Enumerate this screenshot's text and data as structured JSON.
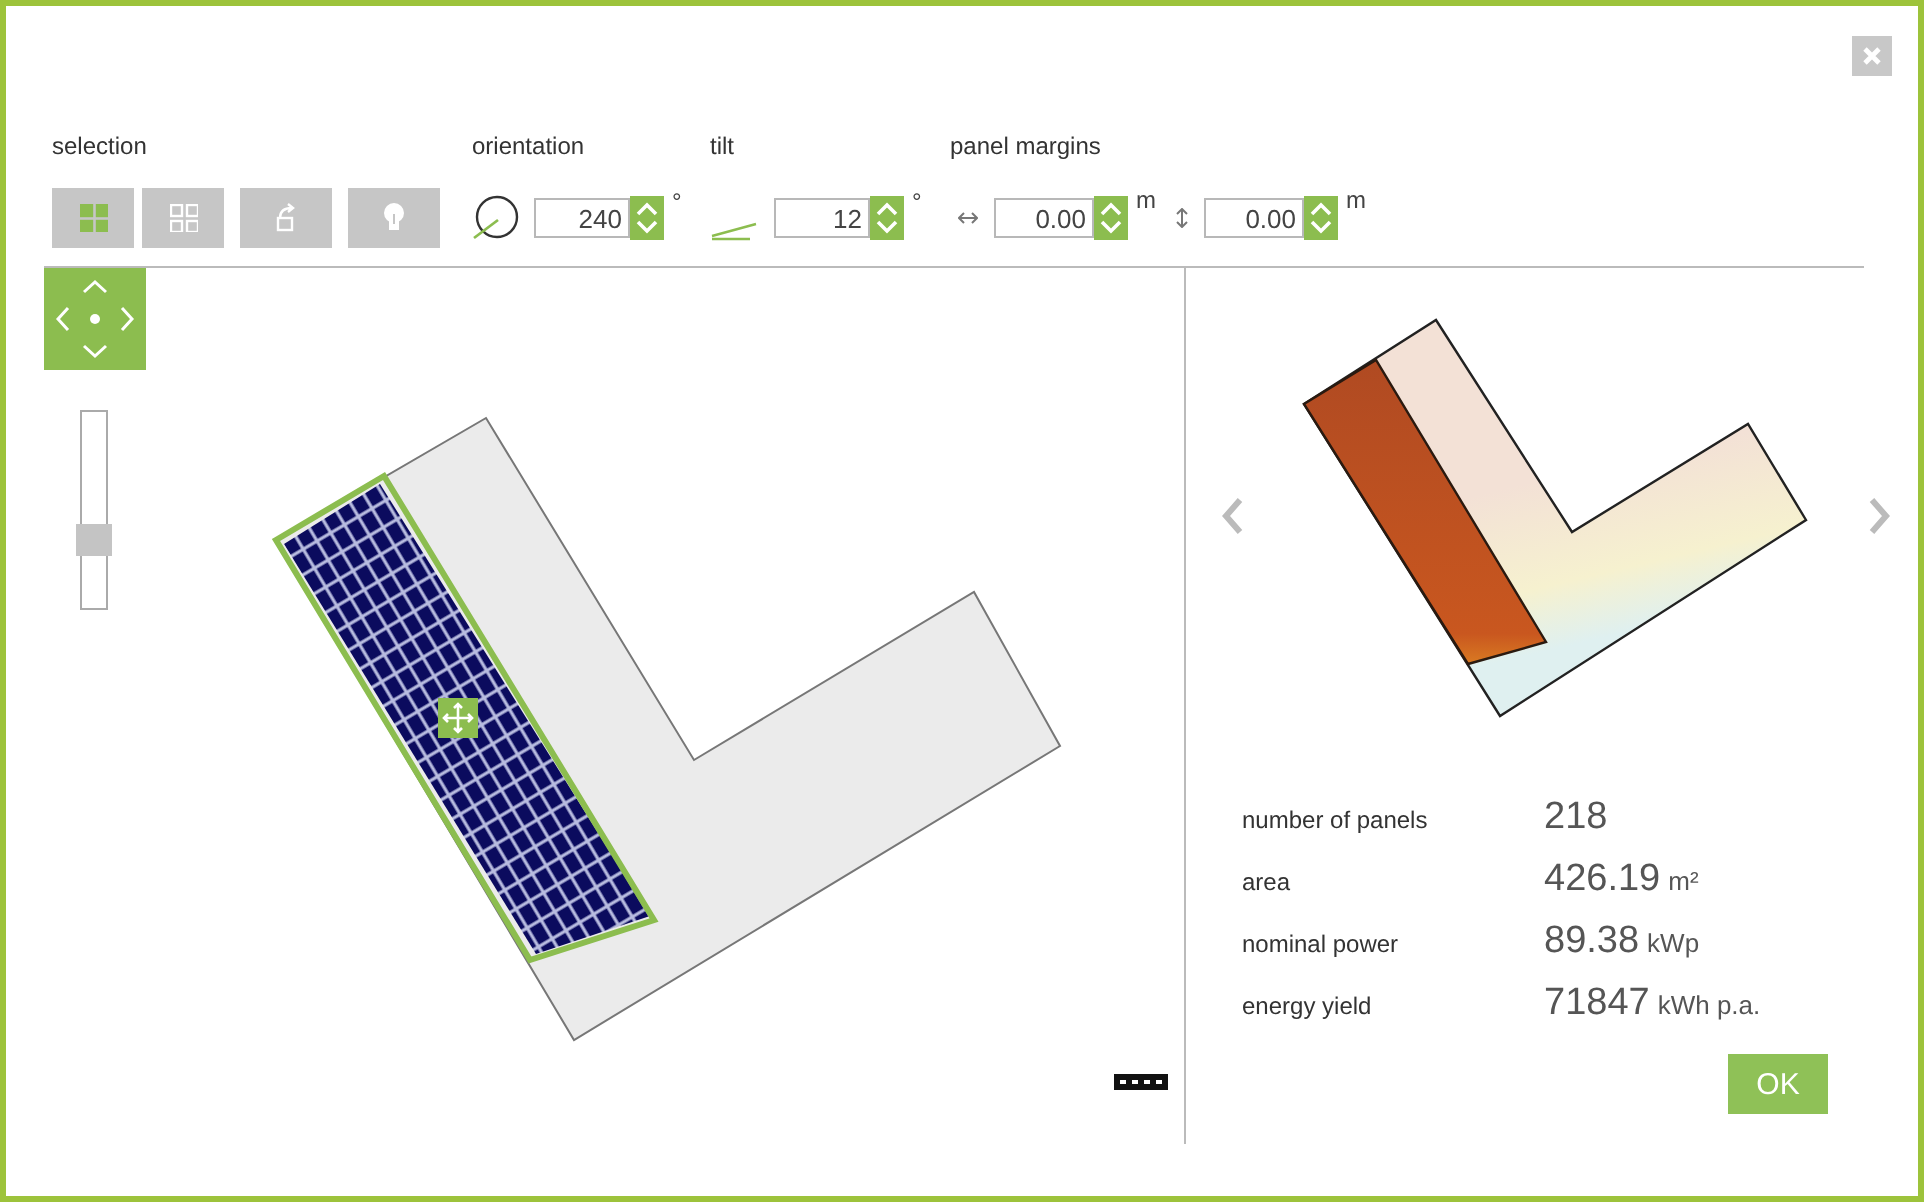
{
  "toolbar": {
    "selection": {
      "label": "selection",
      "buttons": [
        {
          "kind": "grid",
          "selected": true
        },
        {
          "kind": "grid",
          "selected": false
        },
        {
          "kind": "rotate"
        },
        {
          "kind": "bulb"
        }
      ]
    },
    "orientation": {
      "label": "orientation",
      "value": "240",
      "unit": "°"
    },
    "tilt": {
      "label": "tilt",
      "value": "12",
      "unit": "°"
    },
    "panel_margins": {
      "label": "panel margins",
      "fields": [
        {
          "kind": "horizontal",
          "value": "0.00",
          "unit": "m"
        },
        {
          "kind": "vertical",
          "value": "0.00",
          "unit": "m"
        }
      ]
    }
  },
  "zoom_slider": {
    "level": 0.33
  },
  "stats": [
    {
      "label": "number of panels",
      "value": "218"
    },
    {
      "label": "area",
      "value": "426.19",
      "unit": "m²"
    },
    {
      "label": "nominal power",
      "value": "89.38",
      "unit": "kWp"
    },
    {
      "label": "energy yield",
      "value": "71847",
      "unit": "kWh p.a."
    }
  ],
  "ok_button": "OK"
}
